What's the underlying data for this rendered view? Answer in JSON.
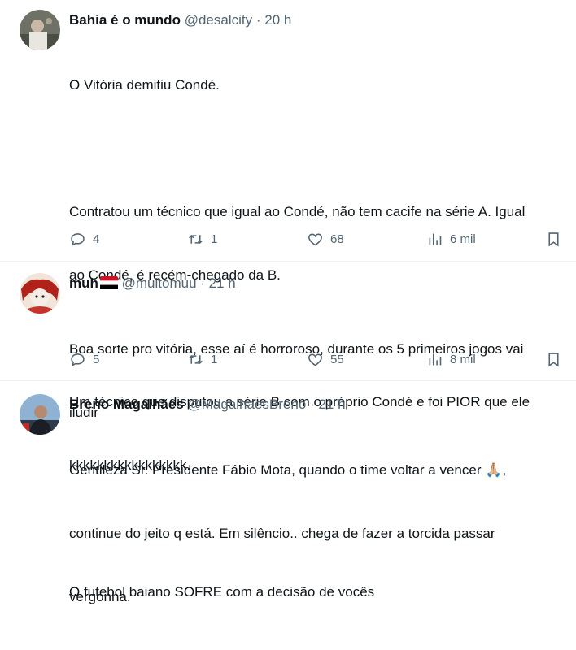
{
  "tweets": [
    {
      "display_name": "Bahia é o mundo",
      "handle": "@desalcity",
      "separator": "·",
      "time": "20 h",
      "lines": [
        "O Vitória demitiu Condé.",
        "",
        "Contratou um técnico que igual ao Condé, não tem cacife na série A. Igual",
        "ao Condé, é recém-chegado da B.",
        "",
        "Um técnico que disputou a série B com o próprio Condé e foi PIOR que ele",
        "kkkkkkkkkkkkkkkkk.",
        "",
        "O futebol baiano SOFRE com a decisão de vocês"
      ],
      "replies": "4",
      "retweets": "1",
      "likes": "68",
      "views": "6 mil"
    },
    {
      "display_name": "muh",
      "handle": "@muitomuu",
      "separator": "·",
      "time": "21 h",
      "lines": [
        "Boa sorte pro vitória, esse aí é horroroso, durante os 5 primeiros jogos vai",
        "iludir"
      ],
      "replies": "5",
      "retweets": "1",
      "likes": "55",
      "views": "8 mil"
    },
    {
      "display_name": "Breno Magalhães",
      "handle": "@MagalhaesBreno",
      "separator": "·",
      "time": "21 h",
      "lines": [
        "Gentileza Sr. Presidente Fábio Mota, quando o time voltar a vencer 🙏🏼,",
        "continue do jeito q está. Em silêncio.. chega de fazer a torcida passar",
        "vergonha."
      ]
    }
  ],
  "icons": {
    "reply": "reply-icon",
    "retweet": "retweet-icon",
    "like": "heart-icon",
    "views": "views-icon",
    "bookmark": "bookmark-icon"
  },
  "colors": {
    "text": "#0f1419",
    "secondary": "#536471",
    "divider": "#eff3f4"
  }
}
